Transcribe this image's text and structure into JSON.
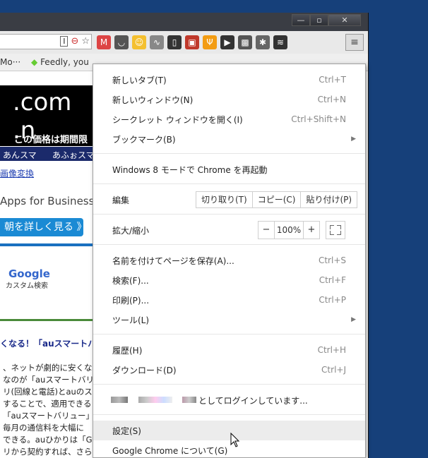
{
  "window": {
    "controls": {
      "minimize": "—",
      "maximize": "▫",
      "close": "✕"
    }
  },
  "toolbar": {
    "omnibox_icons": [
      "I",
      "⊖",
      "☆"
    ],
    "extensions": [
      {
        "name": "gmail-icon",
        "color": "#d44",
        "glyph": "M"
      },
      {
        "name": "pocket-icon",
        "color": "#555",
        "glyph": "◡"
      },
      {
        "name": "smiley-icon",
        "color": "#f4c030",
        "glyph": "☺"
      },
      {
        "name": "pulse-icon",
        "color": "#888",
        "glyph": "∿"
      },
      {
        "name": "phone-icon",
        "color": "#333",
        "glyph": "▯"
      },
      {
        "name": "box-icon",
        "color": "#c0392b",
        "glyph": "▣"
      },
      {
        "name": "fork-icon",
        "color": "#f39c12",
        "glyph": "Ψ"
      },
      {
        "name": "dark-icon",
        "color": "#333",
        "glyph": "▶"
      },
      {
        "name": "puzzle-icon",
        "color": "#555",
        "glyph": "▩"
      },
      {
        "name": "bug-icon",
        "color": "#666",
        "glyph": "✱"
      },
      {
        "name": "layers-icon",
        "color": "#333",
        "glyph": "≋"
      }
    ],
    "menu_glyph": "≡"
  },
  "bookmarks": {
    "items": [
      "Mo···",
      "Feedly, you"
    ]
  },
  "page": {
    "banner_text": ".com .n",
    "promo_text": "この価格は期間限",
    "nav_items": [
      "あんスマ",
      "あふぉスマ"
    ],
    "link_text": "画像変換",
    "apps_text": "Apps for Business",
    "detail_button": "朝を詳しく見る 》",
    "google_text": "Google",
    "google_sub": "カスタム検索",
    "headline": "くなる！「auスマートバ",
    "article_lines": [
      "、ネットが劇的に安くなる",
      "なのが「auスマートバリュ",
      "リ(回線と電話)とauのス",
      "することで、適用できる",
      "「auスマートバリュー」を",
      "毎月の通信料を大幅に",
      "できる。auひかりは「GM",
      "リから契約すれば、さらに",
      "！"
    ]
  },
  "menu": {
    "new_tab": {
      "label": "新しいタブ(T)",
      "shortcut": "Ctrl+T"
    },
    "new_window": {
      "label": "新しいウィンドウ(N)",
      "shortcut": "Ctrl+N"
    },
    "incognito": {
      "label": "シークレット ウィンドウを開く(I)",
      "shortcut": "Ctrl+Shift+N"
    },
    "bookmarks": {
      "label": "ブックマーク(B)"
    },
    "relaunch_win8": {
      "label": "Windows 8 モードで Chrome を再起動"
    },
    "edit": {
      "label": "編集",
      "cut": "切り取り(T)",
      "copy": "コピー(C)",
      "paste": "貼り付け(P)"
    },
    "zoom": {
      "label": "拡大/縮小",
      "minus": "−",
      "value": "100%",
      "plus": "+"
    },
    "save_page": {
      "label": "名前を付けてページを保存(A)...",
      "shortcut": "Ctrl+S"
    },
    "find": {
      "label": "検索(F)...",
      "shortcut": "Ctrl+F"
    },
    "print": {
      "label": "印刷(P)...",
      "shortcut": "Ctrl+P"
    },
    "tools": {
      "label": "ツール(L)"
    },
    "history": {
      "label": "履歴(H)",
      "shortcut": "Ctrl+H"
    },
    "downloads": {
      "label": "ダウンロード(D)",
      "shortcut": "Ctrl+J"
    },
    "signin": {
      "label": "としてログインしています..."
    },
    "settings": {
      "label": "設定(S)"
    },
    "about": {
      "label": "Google Chrome について(G)"
    }
  }
}
